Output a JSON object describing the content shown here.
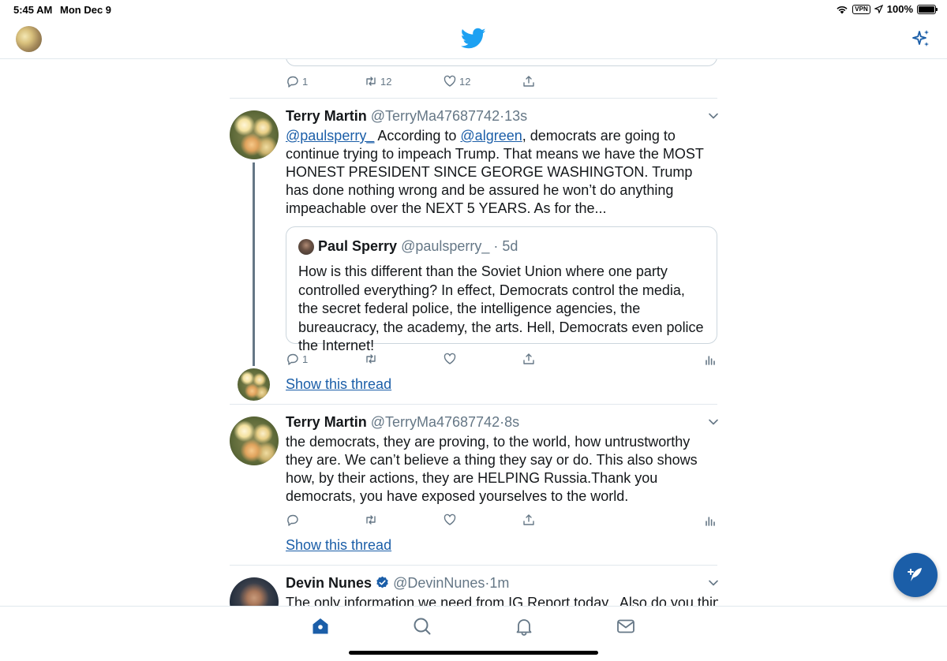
{
  "status_bar": {
    "time": "5:45 AM",
    "date": "Mon Dec 9",
    "vpn": "VPN",
    "battery": "100%"
  },
  "nav": {
    "logo_icon": "twitter-bird-icon",
    "sparkle_icon": "sparkle-icon"
  },
  "tweets": [
    {
      "actions": {
        "reply_count": "1",
        "retweet_count": "12",
        "like_count": "12"
      }
    },
    {
      "name": "Terry Martin",
      "handle": "@TerryMa47687742",
      "sep": "·",
      "time": "13s",
      "mention_1": "@paulsperry_",
      "text_1": " According to ",
      "mention_2": "@algreen",
      "text_2": ", democrats are going to continue trying to impeach Trump. That means we have the MOST HONEST PRESIDENT SINCE GEORGE WASHINGTON. Trump has done nothing wrong and be assured he won’t do anything impeachable over the NEXT 5 YEARS. As for the...",
      "quote": {
        "name": "Paul Sperry",
        "handle": "@paulsperry_",
        "sep": "·",
        "time": "5d",
        "text": "How is this different than the Soviet Union where one party controlled everything? In effect, Democrats control the media, the secret federal police, the intelligence agencies, the bureaucracy, the academy, the arts. Hell, Democrats even police the Internet!"
      },
      "actions": {
        "reply_count": "1"
      },
      "show_thread": "Show this thread"
    },
    {
      "name": "Terry Martin",
      "handle": "@TerryMa47687742",
      "sep": "·",
      "time": "8s",
      "text": "the democrats, they are proving, to the world, how untrustworthy they are. We can’t believe a thing they say or do. This also shows how, by their actions, they are HELPING Russia.Thank you democrats, you have exposed yourselves to the world.",
      "show_thread": "Show this thread"
    },
    {
      "name": "Devin Nunes",
      "handle": "@DevinNunes",
      "sep": "·",
      "time": "1m",
      "text": "The only information we need from IG Report today...Also do you think"
    }
  ],
  "colors": {
    "brand_blue": "#1b5ea8",
    "twitter_blue": "#1da1f2",
    "muted": "#657786",
    "divider": "#e1e8ed"
  },
  "tab_bar": {
    "tabs": [
      "home-icon",
      "search-icon",
      "notifications-bell-icon",
      "messages-envelope-icon"
    ]
  }
}
